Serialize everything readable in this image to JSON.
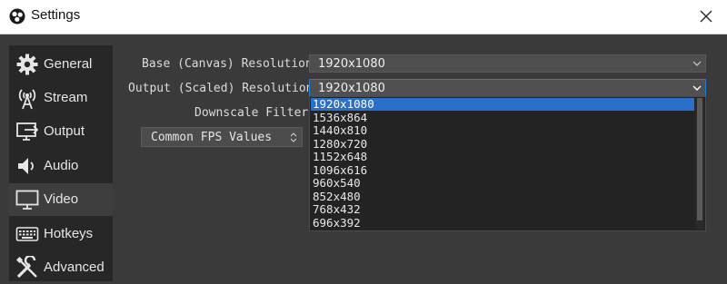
{
  "window": {
    "title": "Settings",
    "close_icon": "close-icon",
    "logo_icon": "obs-logo-icon"
  },
  "sidebar": {
    "items": [
      {
        "label": "General",
        "icon": "gear-icon",
        "active": false
      },
      {
        "label": "Stream",
        "icon": "broadcast-antenna-icon",
        "active": false
      },
      {
        "label": "Output",
        "icon": "monitor-output-icon",
        "active": false
      },
      {
        "label": "Audio",
        "icon": "speaker-icon",
        "active": false
      },
      {
        "label": "Video",
        "icon": "monitor-icon",
        "active": true
      },
      {
        "label": "Hotkeys",
        "icon": "keyboard-icon",
        "active": false
      },
      {
        "label": "Advanced",
        "icon": "tools-icon",
        "active": false
      }
    ]
  },
  "video": {
    "base_label": "Base (Canvas) Resolution",
    "base_value": "1920x1080",
    "output_label": "Output (Scaled) Resolution",
    "output_value": "1920x1080",
    "downscale_label": "Downscale Filter",
    "fps_value": "Common FPS Values"
  },
  "dropdown": {
    "options": [
      "1920x1080",
      "1536x864",
      "1440x810",
      "1280x720",
      "1152x648",
      "1096x616",
      "960x540",
      "852x480",
      "768x432",
      "696x392"
    ],
    "selected_index": 0
  },
  "colors": {
    "background": "#3a3a3a",
    "sidebar": "#272727",
    "selection": "#2a6fcc",
    "focus_border": "#1f7ed6"
  }
}
